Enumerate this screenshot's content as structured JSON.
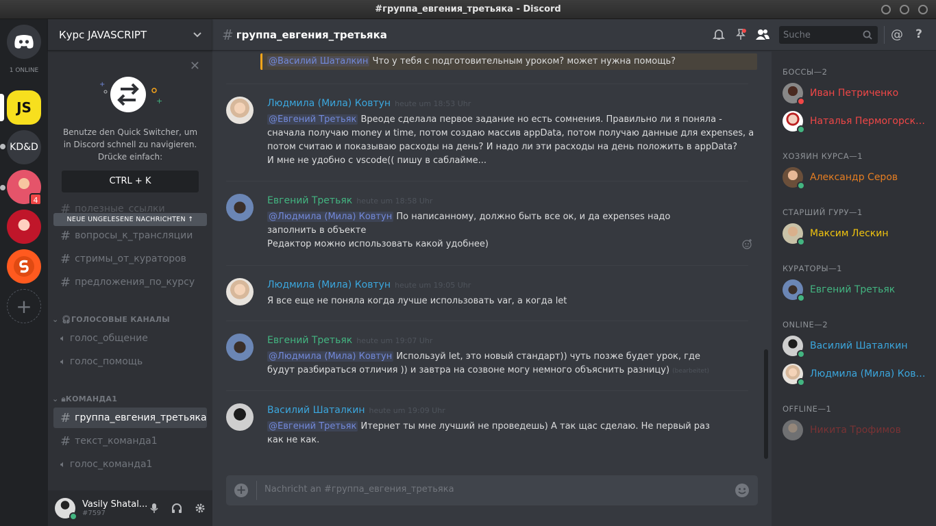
{
  "window": {
    "title": "#группа_евгения_третьяка - Discord"
  },
  "guilds": {
    "online_label": "1 ONLINE",
    "items": [
      {
        "label": "JS",
        "bg": "#f7df1e",
        "color": "#111"
      },
      {
        "label": "KD&D",
        "bg": "#36393f",
        "color": "#fff"
      },
      {
        "label": "",
        "bg": "#e5546a",
        "badge": "4"
      },
      {
        "label": "",
        "bg": "#c0162a"
      },
      {
        "label": "",
        "bg": "#ff5a1f"
      }
    ]
  },
  "server": {
    "name": "Курс JAVASCRIPT"
  },
  "quick_switcher": {
    "description": "Benutze den Quick Switcher, um in Discord schnell zu navigieren. Drücke einfach:",
    "shortcut": "CTRL + K"
  },
  "new_banner": "NEUE UNGELESENE NACHRICHTEN",
  "channels": {
    "text": [
      {
        "name": "полезные_ссылки"
      },
      {
        "name": "вопросы_к_трансляции"
      },
      {
        "name": "стримы_от_кураторов"
      },
      {
        "name": "предложения_по_курсу"
      }
    ],
    "voice_category": "ГОЛОСОВЫЕ КАНАЛЫ",
    "voice": [
      {
        "name": "голос_общение"
      },
      {
        "name": "голос_помощь"
      }
    ],
    "team_category": "КОМАНДА1",
    "team": [
      {
        "name": "группа_евгения_третьяка"
      },
      {
        "name": "текст_команда1"
      },
      {
        "name": "голос_команда1"
      }
    ]
  },
  "user": {
    "name": "Vasily Shatal...",
    "tag": "#7597"
  },
  "chat": {
    "channel": "группа_евгения_третьяка",
    "search_placeholder": "Suche",
    "top_quote": {
      "mention": "@Василий Шаталкин",
      "text": " Что у тебя с подготовительным уроком? может нужна помощь?"
    },
    "messages": [
      {
        "author": "Людмила (Мила) Ковтун",
        "color": "#3ba7de",
        "time": "heute um 18:53 Uhr",
        "mention": "@Евгений Третьяк",
        "line1": " Вреоде сделала первое задание но есть сомнения. Правильно ли я поняла  - сначала получаю money и time, потом создаю массив appData, потом получаю данные для expenses, а потом считаю и показываю расходы на день? И надо ли эти расходы на день положить в appData?",
        "line2": "И мне не удобно с vscode(( пишу в саблайме..."
      },
      {
        "author": "Евгений Третьяк",
        "color": "#43b581",
        "time": "heute um 18:58 Uhr",
        "mention": "@Людмила (Мила) Ковтун",
        "line1": " По написанному, должно быть все ок, и да expenses надо заполнить в объекте",
        "line2": "Редактор можно использовать какой удобнее)"
      },
      {
        "author": "Людмила (Мила) Ковтун",
        "color": "#3ba7de",
        "time": "heute um 19:05 Uhr",
        "line1": "Я все еще не поняла когда лучше  использовать var, а когда let"
      },
      {
        "author": "Евгений Третьяк",
        "color": "#43b581",
        "time": "heute um 19:07 Uhr",
        "mention": "@Людмила (Мила) Ковтун",
        "line1": " Используй let, это новый стандарт)) чуть позже будет урок, где будут разбираться отличия )) и завтра на созвоне могу немного объяснить разницу)",
        "edited": "(bearbeitet)"
      },
      {
        "author": "Василий Шаталкин",
        "color": "#3ba7de",
        "time": "heute um 19:09 Uhr",
        "mention": "@Евгений Третьяк",
        "line1": " Итернет ты мне лучший не проведешь) А так щас сделаю. Не первый раз как не как."
      }
    ],
    "composer_placeholder": "Nachricht an #группа_евгения_третьяка"
  },
  "members": {
    "categories": [
      {
        "title": "БОССЫ—2",
        "members": [
          {
            "name": "Иван Петриченко",
            "color": "#f04747",
            "status": "#f04747"
          },
          {
            "name": "Наталья Пермогорская",
            "color": "#f04747",
            "status": "#43b581"
          }
        ]
      },
      {
        "title": "ХОЗЯИН КУРСА—1",
        "members": [
          {
            "name": "Александр Серов",
            "color": "#e67e22",
            "status": "#43b581"
          }
        ]
      },
      {
        "title": "СТАРШИЙ ГУРУ—1",
        "members": [
          {
            "name": "Максим Лескин",
            "color": "#f1c40f",
            "status": "#43b581"
          }
        ]
      },
      {
        "title": "КУРАТОРЫ—1",
        "members": [
          {
            "name": "Евгений Третьяк",
            "color": "#43b581",
            "status": "#43b581"
          }
        ]
      },
      {
        "title": "ONLINE—2",
        "members": [
          {
            "name": "Василий Шаталкин",
            "color": "#3ba7de",
            "status": "#43b581"
          },
          {
            "name": "Людмила (Мила) Ковт...",
            "color": "#3ba7de",
            "status": "#43b581"
          }
        ]
      },
      {
        "title": "OFFLINE—1",
        "members": [
          {
            "name": "Никита Трофимов",
            "color": "#7a2a2a",
            "status": ""
          }
        ]
      }
    ]
  }
}
